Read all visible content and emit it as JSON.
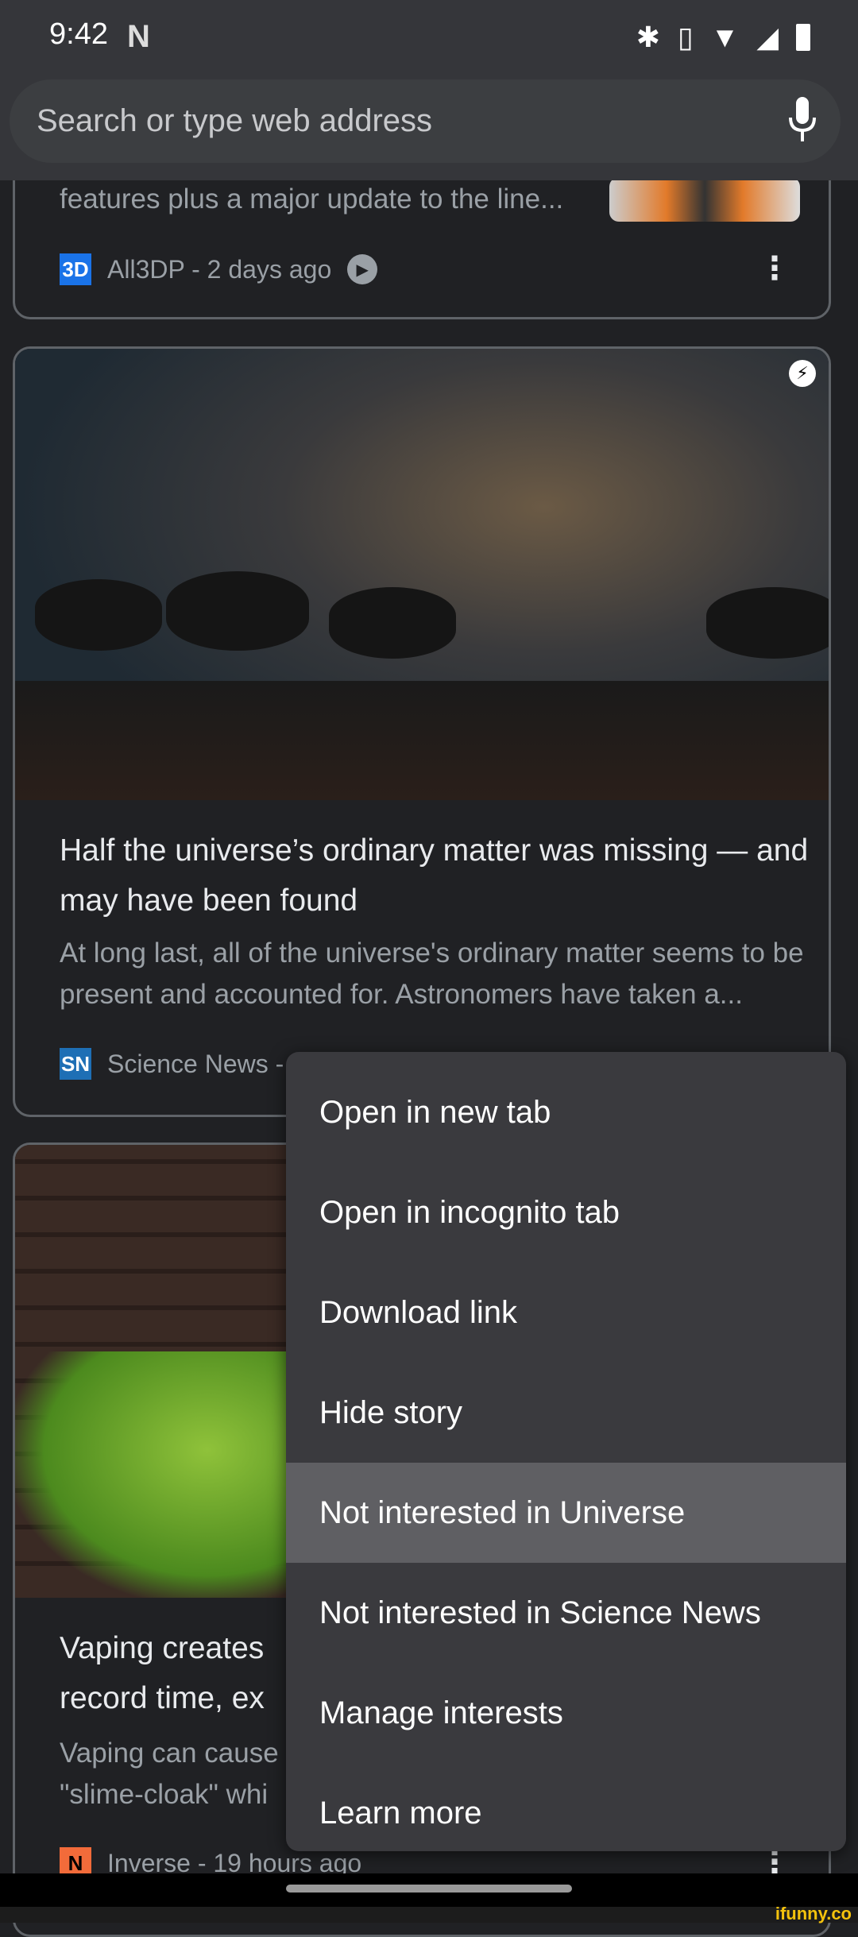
{
  "status_bar": {
    "time": "9:42",
    "notification_icon": "N",
    "icons": [
      "bluetooth-icon",
      "vibrate-icon",
      "wifi-icon",
      "signal-icon",
      "battery-icon"
    ]
  },
  "search": {
    "placeholder": "Search or type web address",
    "mic_icon": "mic-icon"
  },
  "cards": [
    {
      "desc_tail": "features plus a major update to the line...",
      "source": "All3DP - 2 days ago",
      "logo": "3D",
      "logo_color": "#1a73e8"
    },
    {
      "title": "Half the universe’s ordinary matter was missing — and may have been found",
      "desc": "At long last, all of the universe's ordinary matter seems to be present and accounted for. Astronomers have taken a...",
      "source": "Science News -",
      "logo": "SN",
      "logo_color": "#1e6fb5"
    },
    {
      "title_l1": "Vaping creates",
      "title_l2": "record time, ex",
      "desc_l1": "Vaping can cause",
      "desc_l2": "\"slime-cloak\" whi",
      "source": "Inverse - 19 hours ago",
      "logo": "N",
      "logo_color": "#f26b3a"
    }
  ],
  "menu": {
    "items": [
      "Open in new tab",
      "Open in incognito tab",
      "Download link",
      "Hide story",
      "Not interested in Universe",
      "Not interested in Science News",
      "Manage interests",
      "Learn more"
    ],
    "highlighted": "Not interested in Universe"
  },
  "watermark": "ifunny.co"
}
